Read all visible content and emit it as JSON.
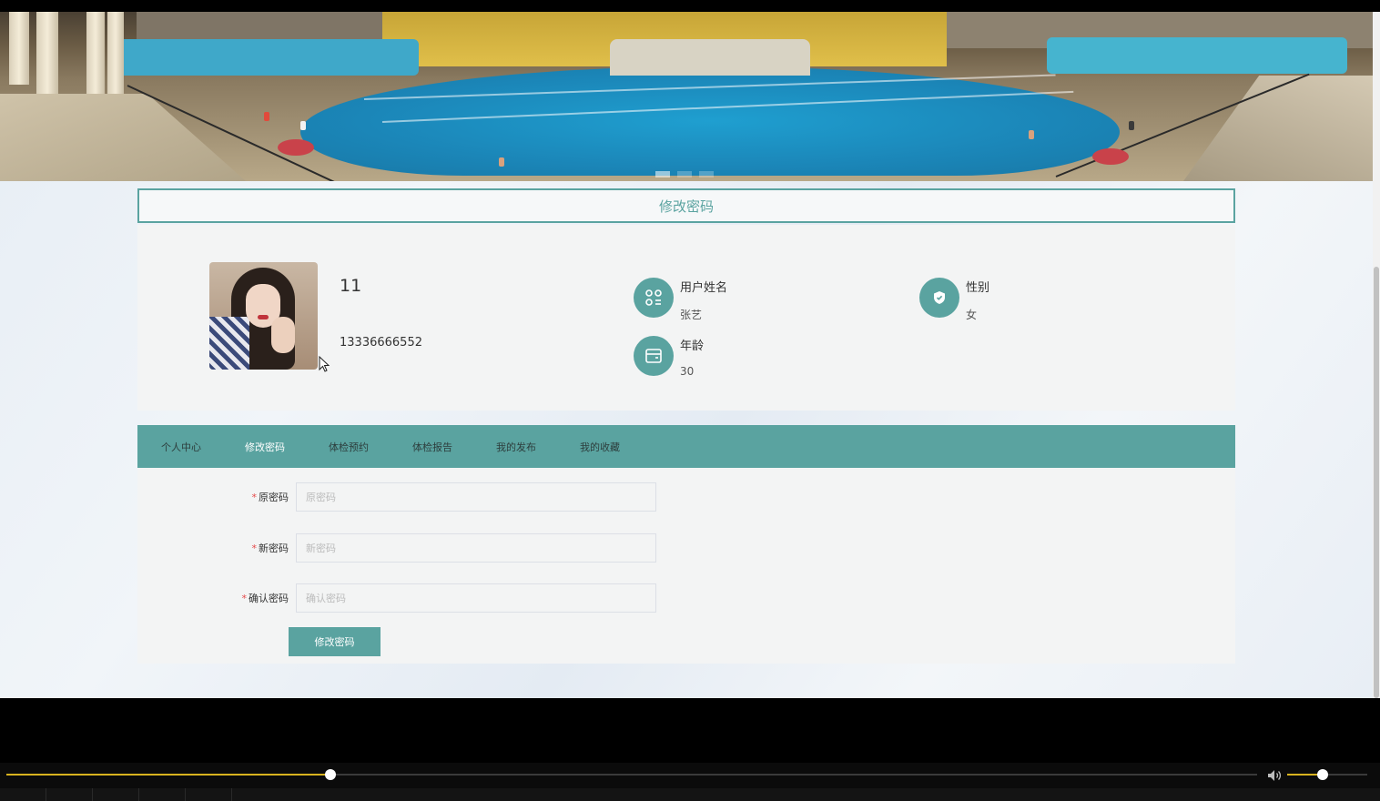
{
  "page": {
    "title": "修改密码"
  },
  "profile": {
    "name": "11",
    "phone": "13336666552",
    "fields": [
      {
        "label": "用户姓名",
        "value": "张艺",
        "icon": "apps-icon"
      },
      {
        "label": "性别",
        "value": "女",
        "icon": "shield-icon"
      },
      {
        "label": "年龄",
        "value": "30",
        "icon": "wallet-icon"
      }
    ]
  },
  "tabs": [
    {
      "label": "个人中心",
      "active": false
    },
    {
      "label": "修改密码",
      "active": true
    },
    {
      "label": "体检预约",
      "active": false
    },
    {
      "label": "体检报告",
      "active": false
    },
    {
      "label": "我的发布",
      "active": false
    },
    {
      "label": "我的收藏",
      "active": false
    }
  ],
  "form": {
    "required_mark": "*",
    "old_password": {
      "label": "原密码",
      "placeholder": "原密码"
    },
    "new_password": {
      "label": "新密码",
      "placeholder": "新密码"
    },
    "confirm_password": {
      "label": "确认密码",
      "placeholder": "确认密码"
    },
    "submit_label": "修改密码"
  },
  "player": {
    "progress": 0.259,
    "volume": 0.44,
    "accent_color": "#d8b21f"
  },
  "colors": {
    "theme": "#5aa3a0",
    "required": "#e64a4a"
  }
}
